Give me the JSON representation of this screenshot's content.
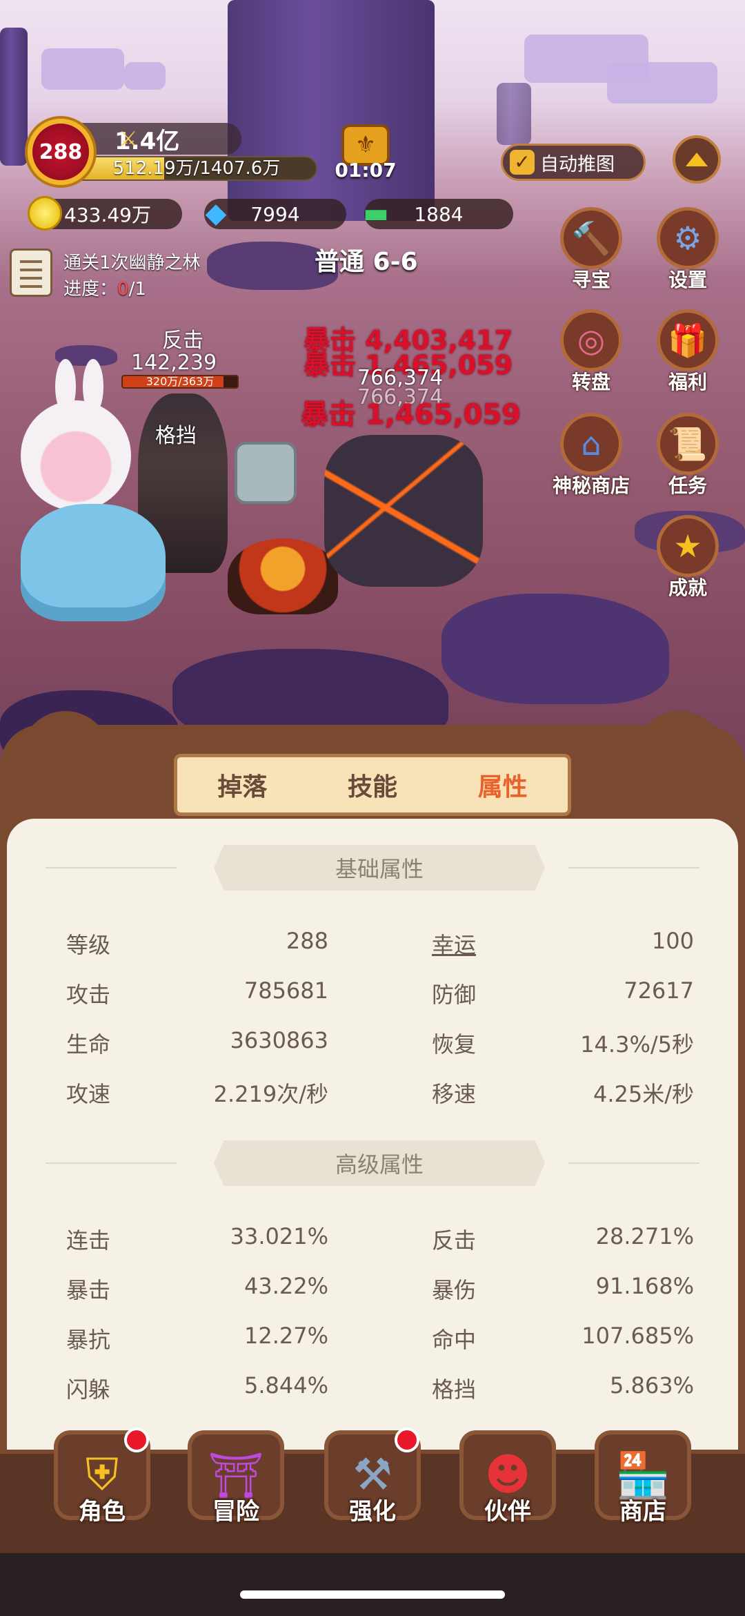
{
  "player": {
    "level": "288",
    "power": "1.4亿",
    "exp_text": "512.19万/1407.6万",
    "exp_fraction": 0.364
  },
  "timer": "01:07",
  "auto_push_label": "自动推图",
  "currency": {
    "gold": "433.49万",
    "diamond": "7994",
    "cash": "1884"
  },
  "quest": {
    "title": "通关1次幽静之林",
    "progress_label": "进度：",
    "progress_current": "0",
    "progress_total": "/1"
  },
  "stage": "普通 6-6",
  "side_menu": {
    "treasure": "寻宝",
    "settings": "设置",
    "wheel": "转盘",
    "welfare": "福利",
    "mystery_shop": "神秘商店",
    "tasks": "任务",
    "achievements": "成就"
  },
  "combat": {
    "counter_label": "反击",
    "counter_value": "142,239",
    "enemy_hp_text": "320万/363万",
    "enemy_hp_fraction": 0.88,
    "block_label": "格挡",
    "crit1": "暴击 4,403,417",
    "crit2": "暴击 1,465,059",
    "hit1": "766,374",
    "hit2": "766,374",
    "crit3": "暴击 1,465,059"
  },
  "tabs": {
    "drop": "掉落",
    "skill": "技能",
    "attr": "属性",
    "active": "attr"
  },
  "basic": {
    "title": "基础属性",
    "rows": [
      {
        "l_name": "等级",
        "l_val": "288",
        "r_name": "幸运",
        "r_val": "100"
      },
      {
        "l_name": "攻击",
        "l_val": "785681",
        "r_name": "防御",
        "r_val": "72617"
      },
      {
        "l_name": "生命",
        "l_val": "3630863",
        "r_name": "恢复",
        "r_val": "14.3%/5秒"
      },
      {
        "l_name": "攻速",
        "l_val": "2.219次/秒",
        "r_name": "移速",
        "r_val": "4.25米/秒"
      }
    ]
  },
  "advanced": {
    "title": "高级属性",
    "rows": [
      {
        "l_name": "连击",
        "l_val": "33.021%",
        "r_name": "反击",
        "r_val": "28.271%"
      },
      {
        "l_name": "暴击",
        "l_val": "43.22%",
        "r_name": "暴伤",
        "r_val": "91.168%"
      },
      {
        "l_name": "暴抗",
        "l_val": "12.27%",
        "r_name": "命中",
        "r_val": "107.685%"
      },
      {
        "l_name": "闪躲",
        "l_val": "5.844%",
        "r_name": "格挡",
        "r_val": "5.863%"
      }
    ]
  },
  "nav": {
    "role": "角色",
    "adventure": "冒险",
    "enhance": "强化",
    "partner": "伙伴",
    "shop": "商店"
  }
}
